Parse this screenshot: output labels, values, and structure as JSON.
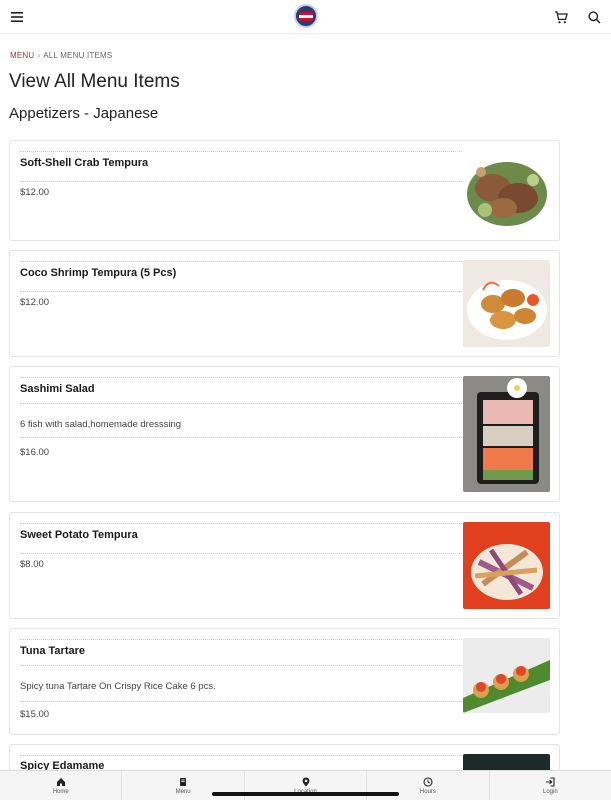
{
  "breadcrumb": {
    "home": "MENU",
    "separator": "›",
    "current": "ALL MENU ITEMS"
  },
  "page_title": "View All Menu Items",
  "section_title": "Appetizers - Japanese",
  "items": [
    {
      "name": "Soft-Shell Crab Tempura",
      "description": "",
      "price": "$12.00",
      "image": "soft-shell-crab-photo"
    },
    {
      "name": "Coco Shrimp Tempura (5 Pcs)",
      "description": "",
      "price": "$12.00",
      "image": "coco-shrimp-photo"
    },
    {
      "name": "Sashimi Salad",
      "description": "6 fish with salad,homemade dresssing",
      "price": "$16.00",
      "image": "sashimi-salad-photo"
    },
    {
      "name": "Sweet Potato Tempura",
      "description": "",
      "price": "$8.00",
      "image": "sweet-potato-photo"
    },
    {
      "name": "Tuna Tartare",
      "description": "Spicy tuna Tartare On Crispy Rice Cake 6 pcs.",
      "price": "$15.00",
      "image": "tuna-tartare-photo"
    },
    {
      "name": "Spicy Edamame",
      "description": "",
      "price": "",
      "image": "edamame-photo"
    }
  ],
  "bottom_nav": [
    {
      "label": "Home",
      "icon": "home-icon"
    },
    {
      "label": "Menu",
      "icon": "menu-book-icon"
    },
    {
      "label": "Location",
      "icon": "location-pin-icon"
    },
    {
      "label": "Hours",
      "icon": "clock-icon"
    },
    {
      "label": "Login",
      "icon": "login-icon"
    }
  ],
  "colors": {
    "accent": "#b5322d",
    "nav_background": "#f5f5f5",
    "border": "#e3e3e3"
  }
}
